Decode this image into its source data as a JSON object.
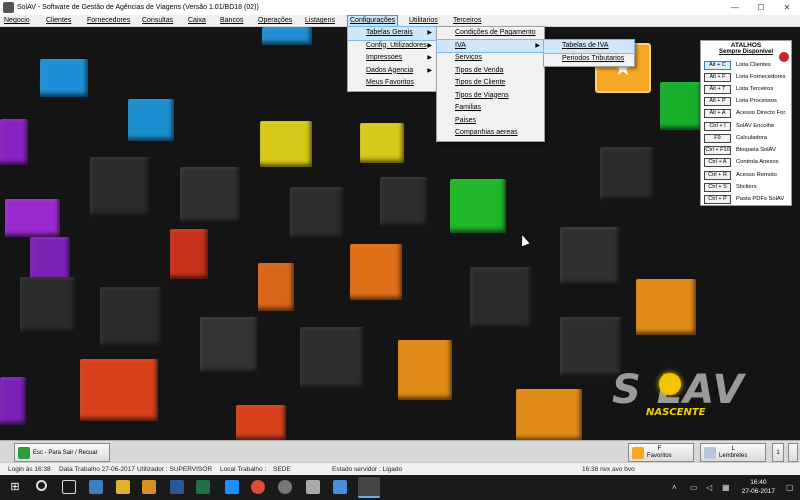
{
  "window": {
    "title": "SolAV - Software de Gestão de Agências de Viagens (Versão 1.01/BD18 (02))",
    "minimize": "—",
    "maximize": "☐",
    "close": "✕"
  },
  "menubar": [
    "Negocio",
    "Clientes",
    "Fornecedores",
    "Consultas",
    "Caixa",
    "Bancos",
    "Operações",
    "Listagens",
    "Configurações",
    "Utilitarios",
    "Terceiros"
  ],
  "menus": {
    "configuracoes": [
      "Tabelas Gerais",
      "Config. Utilizadores",
      "Impressoes",
      "Dados Agencia",
      "Meus Favoritos"
    ],
    "tabelas_gerais": [
      "Condições de Pagamento",
      "IVA",
      "Serviços",
      "Tipos de Venda",
      "Tipos de Cliente",
      "Tipos de Viagens",
      "Familias",
      "Paises",
      "Companhias aereas"
    ],
    "iva": [
      "Tabelas de IVA",
      "Periodos Tributarios"
    ]
  },
  "atalhos": {
    "title": "ATALHOS",
    "subtitle": "Sempre Disponível",
    "items": [
      {
        "key": "Alt + C",
        "label": "Lista Clientes"
      },
      {
        "key": "Alt + F",
        "label": "Lista Fornecedores"
      },
      {
        "key": "Alt + T",
        "label": "Lista Terceiros"
      },
      {
        "key": "Alt + P",
        "label": "Lista Processos"
      },
      {
        "key": "Alt + A",
        "label": "Acesso Directo For."
      },
      {
        "key": "Ctrl + I",
        "label": "SolAV Encolhe"
      },
      {
        "key": "F9",
        "label": "Calculadora"
      },
      {
        "key": "Ctrl + F10",
        "label": "Bloqueia SolAV"
      },
      {
        "key": "Ctrl + A",
        "label": "Controla Anexos"
      },
      {
        "key": "Ctrl + R",
        "label": "Acesso Remoto"
      },
      {
        "key": "Ctrl + S",
        "label": "Stickers"
      },
      {
        "key": "Ctrl + P",
        "label": "Pasta PDFs SolAV"
      }
    ]
  },
  "logo": {
    "name": "S LAV",
    "tag": "NASCENTE"
  },
  "toolbar": {
    "esc_button": "Esc - Para Sair / Recuar",
    "favoritos_key": "F",
    "favoritos_label": "Favoritos",
    "lembretes_key": "L",
    "lembretes_label": "Lembretes",
    "extra": "1"
  },
  "status": {
    "login": "Login às 16:38",
    "data_trabalho": "Data Trabalho 27-06-2017",
    "utilizador": "Utilizador : SUPERVISOR",
    "local": "Local Trabalho :",
    "sede": "SEDE",
    "servidor": "Estado servidor : Ligado",
    "time": "16:38 nvx avo bvo"
  },
  "taskbar": {
    "time": "16:40",
    "date": "27-06-2017"
  },
  "colors": {
    "menu_highlight": "#cfe6fb",
    "favorite_tile": "#f5a623",
    "logo_yellow": "#f5d000"
  }
}
